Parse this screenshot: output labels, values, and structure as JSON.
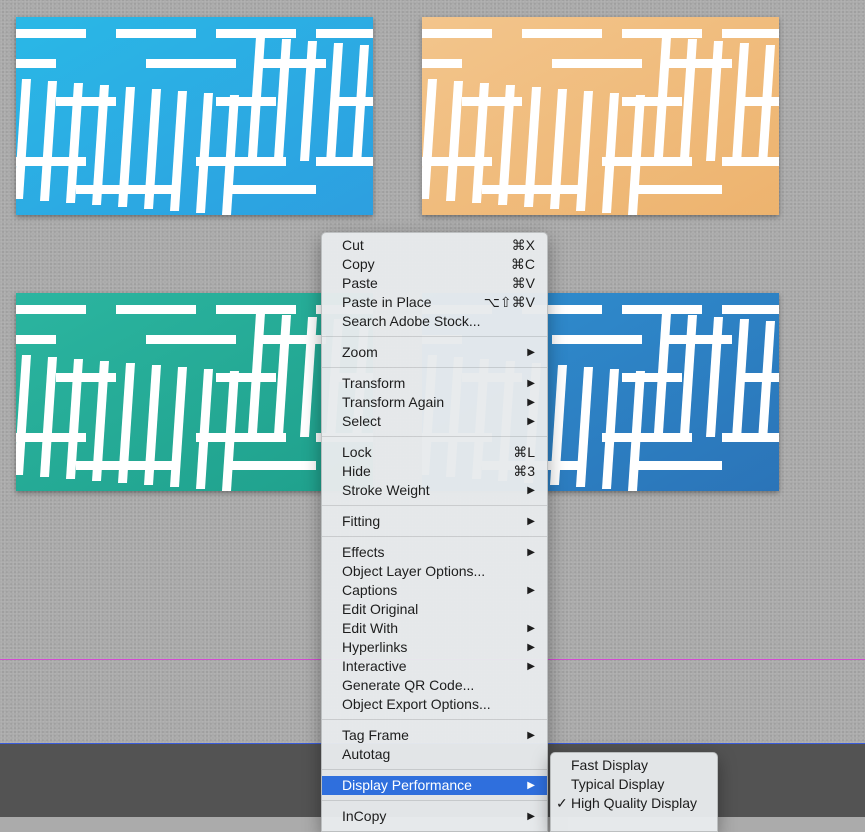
{
  "tiles": [
    {
      "name": "tile-light-blue",
      "colors": [
        "#2ab8e6",
        "#2d9fe0"
      ]
    },
    {
      "name": "tile-orange",
      "colors": [
        "#f3c58c",
        "#edb36e"
      ]
    },
    {
      "name": "tile-teal",
      "colors": [
        "#2bb5a0",
        "#1fa08c"
      ]
    },
    {
      "name": "tile-blue",
      "colors": [
        "#2f8fd0",
        "#2b74b8"
      ]
    }
  ],
  "context_menu": {
    "groups": [
      [
        {
          "label": "Cut",
          "shortcut": "⌘X"
        },
        {
          "label": "Copy",
          "shortcut": "⌘C"
        },
        {
          "label": "Paste",
          "shortcut": "⌘V"
        },
        {
          "label": "Paste in Place",
          "shortcut": "⌥⇧⌘V"
        },
        {
          "label": "Search Adobe Stock...",
          "shortcut": ""
        }
      ],
      [
        {
          "label": "Zoom",
          "submenu": true
        }
      ],
      [
        {
          "label": "Transform",
          "submenu": true
        },
        {
          "label": "Transform Again",
          "submenu": true
        },
        {
          "label": "Select",
          "submenu": true
        }
      ],
      [
        {
          "label": "Lock",
          "shortcut": "⌘L"
        },
        {
          "label": "Hide",
          "shortcut": "⌘3"
        },
        {
          "label": "Stroke Weight",
          "submenu": true
        }
      ],
      [
        {
          "label": "Fitting",
          "submenu": true
        }
      ],
      [
        {
          "label": "Effects",
          "submenu": true
        },
        {
          "label": "Object Layer Options...",
          "shortcut": ""
        },
        {
          "label": "Captions",
          "submenu": true
        },
        {
          "label": "Edit Original",
          "shortcut": ""
        },
        {
          "label": "Edit With",
          "submenu": true
        },
        {
          "label": "Hyperlinks",
          "submenu": true
        },
        {
          "label": "Interactive",
          "submenu": true
        },
        {
          "label": "Generate QR Code...",
          "shortcut": ""
        },
        {
          "label": "Object Export Options...",
          "shortcut": ""
        }
      ],
      [
        {
          "label": "Tag Frame",
          "submenu": true
        },
        {
          "label": "Autotag",
          "shortcut": ""
        }
      ],
      [
        {
          "label": "Display Performance",
          "submenu": true,
          "highlighted": true
        }
      ],
      [
        {
          "label": "InCopy",
          "submenu": true
        }
      ]
    ]
  },
  "display_submenu": {
    "items": [
      {
        "label": "Fast Display",
        "checked": false
      },
      {
        "label": "Typical Display",
        "checked": false
      },
      {
        "label": "High Quality Display",
        "checked": true
      }
    ],
    "check_glyph": "✓"
  },
  "icons": {
    "submenu_arrow": "▶"
  }
}
